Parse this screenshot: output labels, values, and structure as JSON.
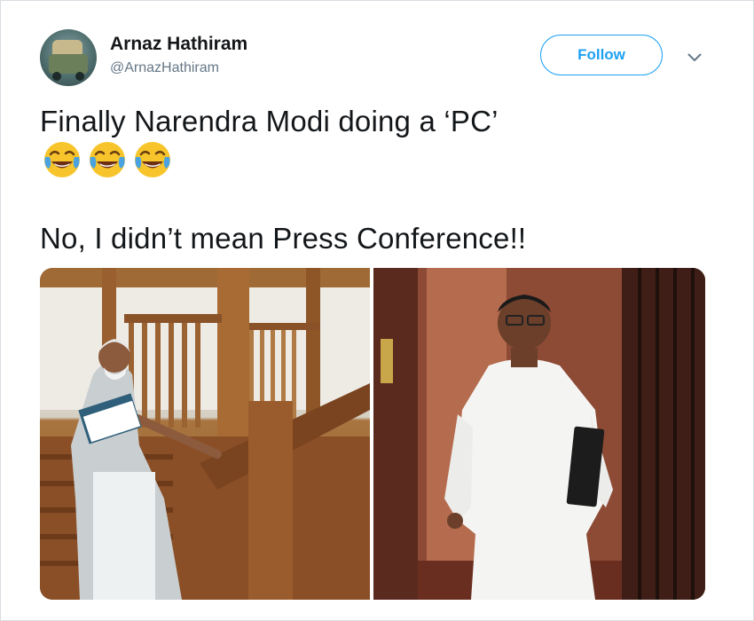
{
  "tweet": {
    "author_name": "Arnaz Hathiram",
    "author_handle": "@ArnazHathiram",
    "follow_label": "Follow",
    "text_line1": "Finally Narendra Modi doing a ‘PC’",
    "emojis": [
      "face-with-tears-of-joy",
      "face-with-tears-of-joy",
      "face-with-tears-of-joy"
    ],
    "text_line2": "No, I didn’t mean Press Conference!!"
  },
  "colors": {
    "accent": "#1da1f2",
    "text": "#14171a",
    "secondary": "#657786"
  },
  "icons": {
    "menu": "chevron-down-icon",
    "avatar": "profile-photo"
  },
  "media": {
    "count": 2
  }
}
